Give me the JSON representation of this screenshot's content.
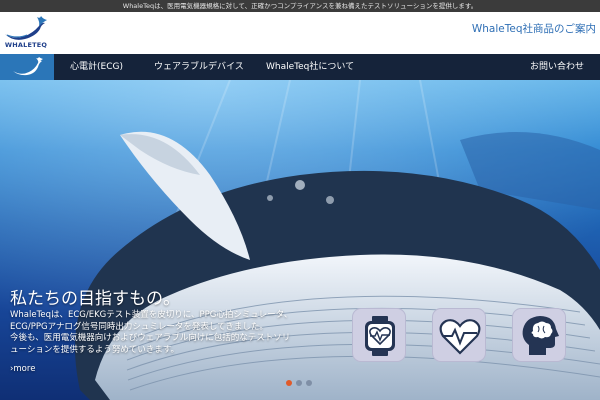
{
  "topbar": {
    "text": "WhaleTeqは、医用電気機器規格に対して、正確かつコンプライアンスを兼ね備えたテストソリューションを提供します。"
  },
  "header": {
    "logo_text": "WHALETEQ",
    "product_link": "WhaleTeq社商品のご案内"
  },
  "nav": {
    "items": [
      {
        "label": "心電計(ECG)"
      },
      {
        "label": "ウェアラブルデバイス"
      },
      {
        "label": "WhaleTeq社について"
      }
    ],
    "contact": "お問い合わせ",
    "home_icon": "whale-tail-icon"
  },
  "hero": {
    "title": "私たちの目指すもの。",
    "body_lines": [
      "WhaleTeqは、ECG/EKGテスト装置を皮切りに、PPG心拍シミュレータ、",
      "ECG/PPGアナログ信号同時出力シュミレータを発表してきました。",
      "今後も、医用電気機器向けおよびウェアラブル向けに包括的なテストソリ",
      "ューションを提供するよう努めていきます。"
    ],
    "more": "›more",
    "features": [
      {
        "icon": "smartwatch-heart-icon"
      },
      {
        "icon": "heart-pulse-icon"
      },
      {
        "icon": "head-brain-icon"
      }
    ],
    "slides": {
      "count": 3,
      "active": 1
    }
  },
  "colors": {
    "topbar": "#3b3b3b",
    "nav": "#15233a",
    "nav_active": "#2b76b8",
    "link": "#2f6fb5",
    "feature_bg": "#cfcfe3",
    "dot_active": "#e05a2a"
  }
}
